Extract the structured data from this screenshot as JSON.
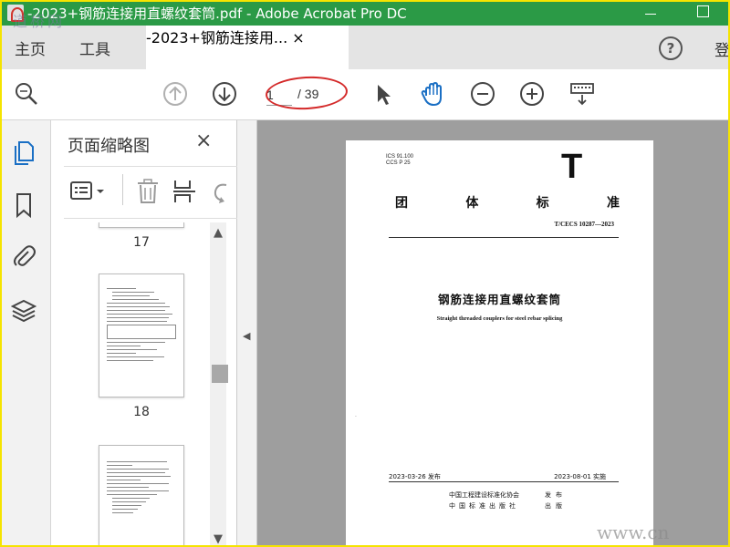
{
  "window": {
    "title": "-2023+钢筋连接用直螺纹套筒.pdf - Adobe Acrobat Pro DC",
    "watermark_top": "道桥网",
    "watermark_bottom": "www.cn"
  },
  "tabs": {
    "home": "主页",
    "tools": "工具",
    "document": "-2023+钢筋连接用...",
    "close": "×",
    "help": "?",
    "login_partial": "登"
  },
  "toolbar": {
    "current_page": "1",
    "total_pages": "/ 39",
    "icons": [
      "search-icon",
      "prev-page-icon",
      "next-page-icon",
      "select-arrow-icon",
      "hand-icon",
      "zoom-out-icon",
      "zoom-in-icon",
      "keyboard-icon"
    ]
  },
  "thumbnail_panel": {
    "title": "页面缩略图",
    "close": "×",
    "pages": [
      {
        "number": "17",
        "current": false
      },
      {
        "number": "18",
        "current": false
      }
    ]
  },
  "pdf_page": {
    "ics": "ICS 91.100",
    "ccs": "CCS P 25",
    "standard_letter": "T",
    "standard_type": [
      "团",
      "体",
      "标",
      "准"
    ],
    "standard_number": "T/CECS 10287—2023",
    "title": "钢筋连接用直螺纹套筒",
    "subtitle": "Straight threaded couplers for steel rebar splicing",
    "issue_date": "2023-03-26 发布",
    "implement_date": "2023-08-01 实施",
    "organization": "中国工程建设标准化协会",
    "publisher": "中国标准出版社",
    "publish_verb": "发布",
    "publish_verb2": "出版"
  },
  "colors": {
    "titlebar": "#2b9a46",
    "accent_blue": "#1a6fc4",
    "annotation_red": "#d42a2a",
    "frame_yellow": "#f5e400"
  }
}
